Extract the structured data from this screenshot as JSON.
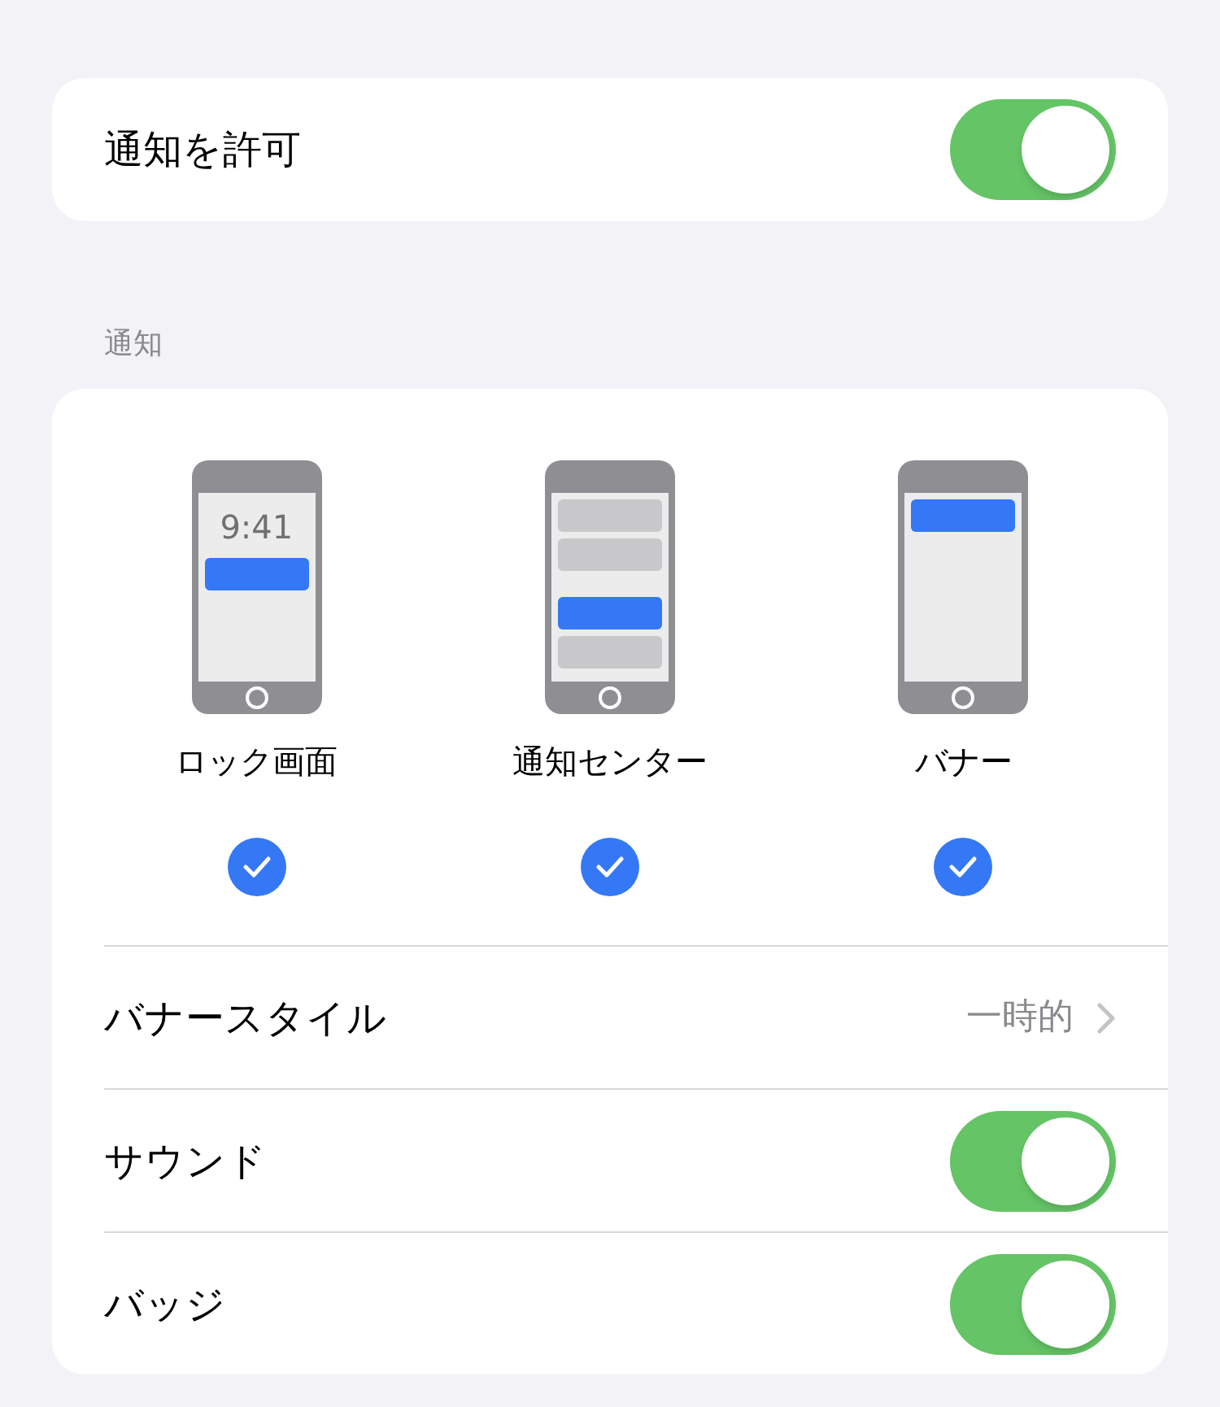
{
  "allow": {
    "label": "通知を許可",
    "on": true
  },
  "section_header": "通知",
  "styles": [
    {
      "kind": "lock",
      "label": "ロック画面",
      "time": "9:41",
      "checked": true
    },
    {
      "kind": "center",
      "label": "通知センター",
      "checked": true
    },
    {
      "kind": "banner",
      "label": "バナー",
      "checked": true
    }
  ],
  "rows": [
    {
      "kind": "link",
      "label": "バナースタイル",
      "value": "一時的"
    },
    {
      "kind": "toggle",
      "label": "サウンド",
      "on": true
    },
    {
      "kind": "toggle",
      "label": "バッジ",
      "on": true
    }
  ]
}
